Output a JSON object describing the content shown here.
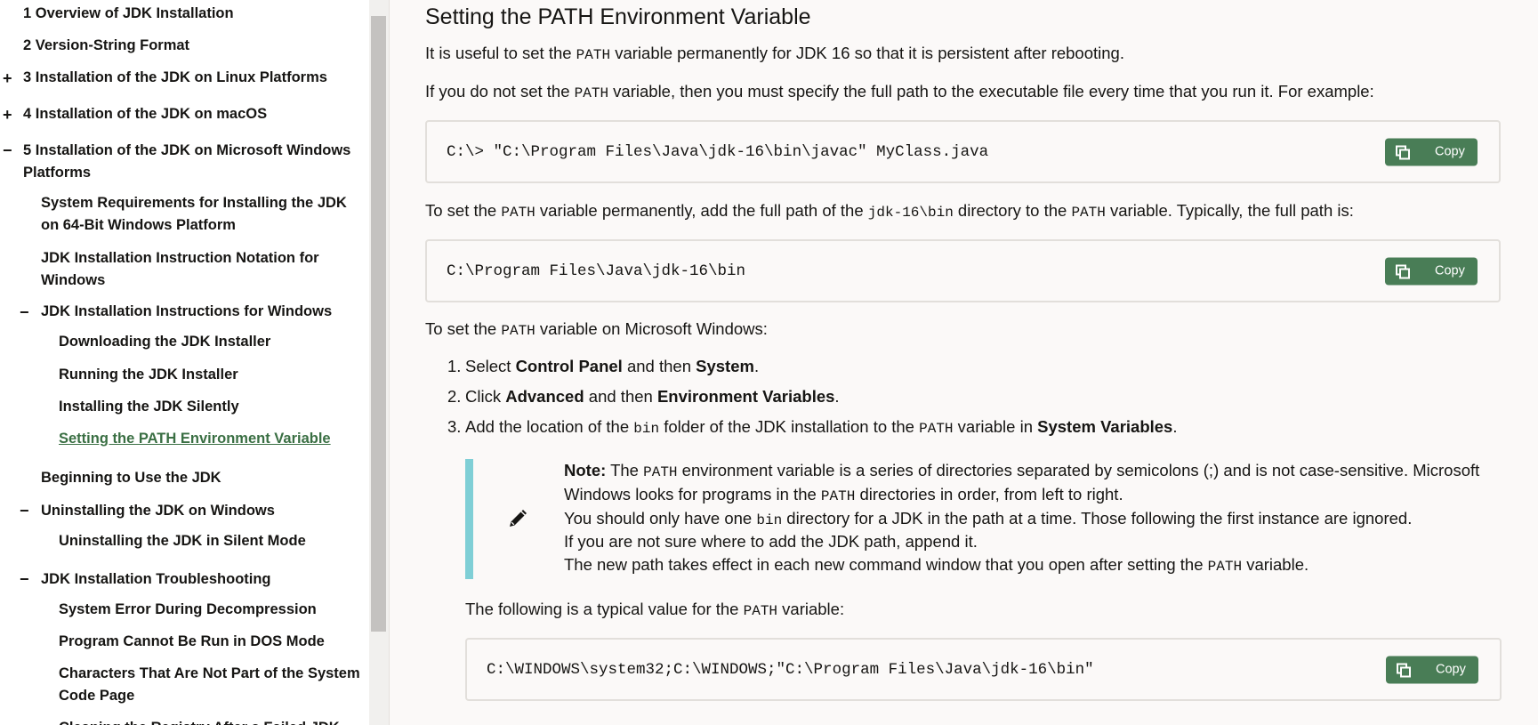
{
  "sidebar": {
    "items": [
      {
        "label": "1 Overview of JDK Installation"
      },
      {
        "label": "2 Version-String Format"
      },
      {
        "toggle": "+",
        "label": "3 Installation of the JDK on Linux Platforms"
      },
      {
        "toggle": "+",
        "label": "4 Installation of the JDK on macOS"
      },
      {
        "toggle": "−",
        "label": "5 Installation of the JDK on Microsoft Windows",
        "label2": "Platforms"
      },
      {
        "label": "System Requirements for Installing the JDK",
        "label2": "on 64-Bit Windows Platform"
      },
      {
        "label": "JDK Installation Instruction Notation for",
        "label2": "Windows"
      },
      {
        "toggle": "−",
        "label": "JDK Installation Instructions for Windows"
      },
      {
        "label": "Downloading the JDK Installer"
      },
      {
        "label": "Running the JDK Installer"
      },
      {
        "label": "Installing the JDK Silently"
      },
      {
        "label": "Setting the PATH Environment Variable",
        "active": true
      },
      {
        "label": "Beginning to Use the JDK"
      },
      {
        "toggle": "−",
        "label": "Uninstalling the JDK on Windows"
      },
      {
        "label": "Uninstalling the JDK in Silent Mode"
      },
      {
        "toggle": "−",
        "label": "JDK Installation Troubleshooting"
      },
      {
        "label": "System Error During Decompression"
      },
      {
        "label": "Program Cannot Be Run in DOS Mode"
      },
      {
        "label": "Characters That Are Not Part of the System",
        "label2": "Code Page"
      },
      {
        "label": "Cleaning the Registry After a Failed JDK"
      }
    ]
  },
  "main": {
    "title": "Setting the PATH Environment Variable",
    "p1": {
      "a": "It is useful to set the ",
      "code": "PATH",
      "b": " variable permanently for JDK 16 so that it is persistent after rebooting."
    },
    "p2": {
      "a": "If you do not set the ",
      "code": "PATH",
      "b": " variable, then you must specify the full path to the executable file every time that you run it. For example:"
    },
    "code1": "C:\\> \"C:\\Program Files\\Java\\jdk-16\\bin\\javac\" MyClass.java",
    "p3": {
      "a": "To set the ",
      "code": "PATH",
      "b": " variable permanently, add the full path of the ",
      "code2": "jdk-16\\bin",
      "c": " directory to the ",
      "code3": "PATH",
      "d": " variable. Typically, the full path is:"
    },
    "code2": "C:\\Program Files\\Java\\jdk-16\\bin",
    "p4": {
      "a": "To set the ",
      "code": "PATH",
      "b": " variable on Microsoft Windows:"
    },
    "steps": [
      {
        "num": "1.",
        "a": "Select ",
        "b1": "Control Panel",
        "mid": " and then ",
        "b2": "System",
        "end": "."
      },
      {
        "num": "2.",
        "a": "Click ",
        "b1": "Advanced",
        "mid": " and then ",
        "b2": "Environment Variables",
        "end": "."
      },
      {
        "num": "3.",
        "a": "Add the location of the ",
        "code": "bin",
        "mid": " folder of the JDK installation to the ",
        "code2": "PATH",
        "mid2": " variable in ",
        "b1": "System Variables",
        "end": "."
      }
    ],
    "note": {
      "label": "Note:",
      "l1a": " The ",
      "l1code": "PATH",
      "l1b": " environment variable is a series of directories separated by semicolons (;) and is not case-sensitive. Microsoft",
      "l2a": "Windows looks for programs in the ",
      "l2code": "PATH",
      "l2b": " directories in order, from left to right.",
      "l3a": "You should only have one ",
      "l3code": "bin",
      "l3b": " directory for a JDK in the path at a time. Those following the first instance are ignored.",
      "l4": "If you are not sure where to add the JDK path, append it.",
      "l5a": "The new path takes effect in each new command window that you open after setting the ",
      "l5code": "PATH",
      "l5b": " variable."
    },
    "p5": {
      "a": "The following is a typical value for the ",
      "code": "PATH",
      "b": " variable:"
    },
    "code3": "C:\\WINDOWS\\system32;C:\\WINDOWS;\"C:\\Program Files\\Java\\jdk-16\\bin\"",
    "copy_label": "Copy"
  },
  "colors": {
    "accent": "#497d56",
    "active_link": "#3a6f43",
    "note_bar": "#7fcfd6"
  }
}
